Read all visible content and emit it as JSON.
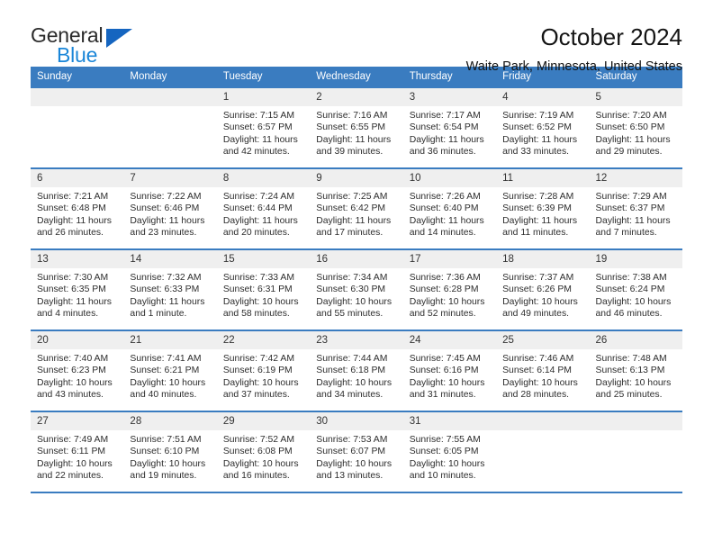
{
  "brand": {
    "word_top": "General",
    "word_bottom": "Blue",
    "triangle_color": "#1565c0",
    "blue_color": "#1a86d8"
  },
  "header": {
    "title": "October 2024",
    "subtitle": "Waite Park, Minnesota, United States"
  },
  "calendar": {
    "header_bg": "#3a7cc0",
    "header_text_color": "#ffffff",
    "daynum_bg": "#efefef",
    "weekday_headers": [
      "Sunday",
      "Monday",
      "Tuesday",
      "Wednesday",
      "Thursday",
      "Friday",
      "Saturday"
    ],
    "weeks": [
      [
        {
          "day": "",
          "sunrise": "",
          "sunset": "",
          "daylight_line1": "",
          "daylight_line2": ""
        },
        {
          "day": "",
          "sunrise": "",
          "sunset": "",
          "daylight_line1": "",
          "daylight_line2": ""
        },
        {
          "day": "1",
          "sunrise": "Sunrise: 7:15 AM",
          "sunset": "Sunset: 6:57 PM",
          "daylight_line1": "Daylight: 11 hours",
          "daylight_line2": "and 42 minutes."
        },
        {
          "day": "2",
          "sunrise": "Sunrise: 7:16 AM",
          "sunset": "Sunset: 6:55 PM",
          "daylight_line1": "Daylight: 11 hours",
          "daylight_line2": "and 39 minutes."
        },
        {
          "day": "3",
          "sunrise": "Sunrise: 7:17 AM",
          "sunset": "Sunset: 6:54 PM",
          "daylight_line1": "Daylight: 11 hours",
          "daylight_line2": "and 36 minutes."
        },
        {
          "day": "4",
          "sunrise": "Sunrise: 7:19 AM",
          "sunset": "Sunset: 6:52 PM",
          "daylight_line1": "Daylight: 11 hours",
          "daylight_line2": "and 33 minutes."
        },
        {
          "day": "5",
          "sunrise": "Sunrise: 7:20 AM",
          "sunset": "Sunset: 6:50 PM",
          "daylight_line1": "Daylight: 11 hours",
          "daylight_line2": "and 29 minutes."
        }
      ],
      [
        {
          "day": "6",
          "sunrise": "Sunrise: 7:21 AM",
          "sunset": "Sunset: 6:48 PM",
          "daylight_line1": "Daylight: 11 hours",
          "daylight_line2": "and 26 minutes."
        },
        {
          "day": "7",
          "sunrise": "Sunrise: 7:22 AM",
          "sunset": "Sunset: 6:46 PM",
          "daylight_line1": "Daylight: 11 hours",
          "daylight_line2": "and 23 minutes."
        },
        {
          "day": "8",
          "sunrise": "Sunrise: 7:24 AM",
          "sunset": "Sunset: 6:44 PM",
          "daylight_line1": "Daylight: 11 hours",
          "daylight_line2": "and 20 minutes."
        },
        {
          "day": "9",
          "sunrise": "Sunrise: 7:25 AM",
          "sunset": "Sunset: 6:42 PM",
          "daylight_line1": "Daylight: 11 hours",
          "daylight_line2": "and 17 minutes."
        },
        {
          "day": "10",
          "sunrise": "Sunrise: 7:26 AM",
          "sunset": "Sunset: 6:40 PM",
          "daylight_line1": "Daylight: 11 hours",
          "daylight_line2": "and 14 minutes."
        },
        {
          "day": "11",
          "sunrise": "Sunrise: 7:28 AM",
          "sunset": "Sunset: 6:39 PM",
          "daylight_line1": "Daylight: 11 hours",
          "daylight_line2": "and 11 minutes."
        },
        {
          "day": "12",
          "sunrise": "Sunrise: 7:29 AM",
          "sunset": "Sunset: 6:37 PM",
          "daylight_line1": "Daylight: 11 hours",
          "daylight_line2": "and 7 minutes."
        }
      ],
      [
        {
          "day": "13",
          "sunrise": "Sunrise: 7:30 AM",
          "sunset": "Sunset: 6:35 PM",
          "daylight_line1": "Daylight: 11 hours",
          "daylight_line2": "and 4 minutes."
        },
        {
          "day": "14",
          "sunrise": "Sunrise: 7:32 AM",
          "sunset": "Sunset: 6:33 PM",
          "daylight_line1": "Daylight: 11 hours",
          "daylight_line2": "and 1 minute."
        },
        {
          "day": "15",
          "sunrise": "Sunrise: 7:33 AM",
          "sunset": "Sunset: 6:31 PM",
          "daylight_line1": "Daylight: 10 hours",
          "daylight_line2": "and 58 minutes."
        },
        {
          "day": "16",
          "sunrise": "Sunrise: 7:34 AM",
          "sunset": "Sunset: 6:30 PM",
          "daylight_line1": "Daylight: 10 hours",
          "daylight_line2": "and 55 minutes."
        },
        {
          "day": "17",
          "sunrise": "Sunrise: 7:36 AM",
          "sunset": "Sunset: 6:28 PM",
          "daylight_line1": "Daylight: 10 hours",
          "daylight_line2": "and 52 minutes."
        },
        {
          "day": "18",
          "sunrise": "Sunrise: 7:37 AM",
          "sunset": "Sunset: 6:26 PM",
          "daylight_line1": "Daylight: 10 hours",
          "daylight_line2": "and 49 minutes."
        },
        {
          "day": "19",
          "sunrise": "Sunrise: 7:38 AM",
          "sunset": "Sunset: 6:24 PM",
          "daylight_line1": "Daylight: 10 hours",
          "daylight_line2": "and 46 minutes."
        }
      ],
      [
        {
          "day": "20",
          "sunrise": "Sunrise: 7:40 AM",
          "sunset": "Sunset: 6:23 PM",
          "daylight_line1": "Daylight: 10 hours",
          "daylight_line2": "and 43 minutes."
        },
        {
          "day": "21",
          "sunrise": "Sunrise: 7:41 AM",
          "sunset": "Sunset: 6:21 PM",
          "daylight_line1": "Daylight: 10 hours",
          "daylight_line2": "and 40 minutes."
        },
        {
          "day": "22",
          "sunrise": "Sunrise: 7:42 AM",
          "sunset": "Sunset: 6:19 PM",
          "daylight_line1": "Daylight: 10 hours",
          "daylight_line2": "and 37 minutes."
        },
        {
          "day": "23",
          "sunrise": "Sunrise: 7:44 AM",
          "sunset": "Sunset: 6:18 PM",
          "daylight_line1": "Daylight: 10 hours",
          "daylight_line2": "and 34 minutes."
        },
        {
          "day": "24",
          "sunrise": "Sunrise: 7:45 AM",
          "sunset": "Sunset: 6:16 PM",
          "daylight_line1": "Daylight: 10 hours",
          "daylight_line2": "and 31 minutes."
        },
        {
          "day": "25",
          "sunrise": "Sunrise: 7:46 AM",
          "sunset": "Sunset: 6:14 PM",
          "daylight_line1": "Daylight: 10 hours",
          "daylight_line2": "and 28 minutes."
        },
        {
          "day": "26",
          "sunrise": "Sunrise: 7:48 AM",
          "sunset": "Sunset: 6:13 PM",
          "daylight_line1": "Daylight: 10 hours",
          "daylight_line2": "and 25 minutes."
        }
      ],
      [
        {
          "day": "27",
          "sunrise": "Sunrise: 7:49 AM",
          "sunset": "Sunset: 6:11 PM",
          "daylight_line1": "Daylight: 10 hours",
          "daylight_line2": "and 22 minutes."
        },
        {
          "day": "28",
          "sunrise": "Sunrise: 7:51 AM",
          "sunset": "Sunset: 6:10 PM",
          "daylight_line1": "Daylight: 10 hours",
          "daylight_line2": "and 19 minutes."
        },
        {
          "day": "29",
          "sunrise": "Sunrise: 7:52 AM",
          "sunset": "Sunset: 6:08 PM",
          "daylight_line1": "Daylight: 10 hours",
          "daylight_line2": "and 16 minutes."
        },
        {
          "day": "30",
          "sunrise": "Sunrise: 7:53 AM",
          "sunset": "Sunset: 6:07 PM",
          "daylight_line1": "Daylight: 10 hours",
          "daylight_line2": "and 13 minutes."
        },
        {
          "day": "31",
          "sunrise": "Sunrise: 7:55 AM",
          "sunset": "Sunset: 6:05 PM",
          "daylight_line1": "Daylight: 10 hours",
          "daylight_line2": "and 10 minutes."
        },
        {
          "day": "",
          "sunrise": "",
          "sunset": "",
          "daylight_line1": "",
          "daylight_line2": ""
        },
        {
          "day": "",
          "sunrise": "",
          "sunset": "",
          "daylight_line1": "",
          "daylight_line2": ""
        }
      ]
    ]
  }
}
